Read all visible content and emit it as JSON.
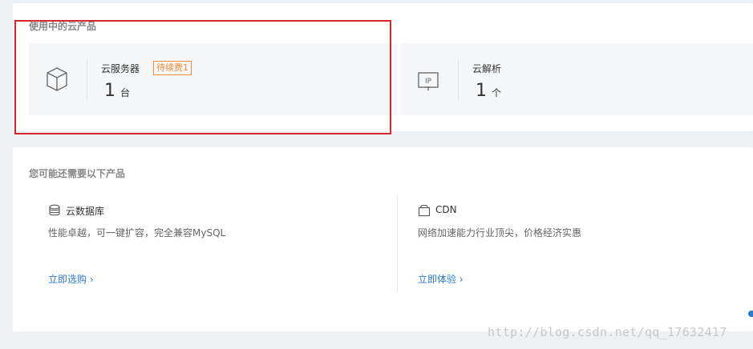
{
  "in_use": {
    "section_title": "使用中的云产品",
    "cards": [
      {
        "icon": "cube-icon",
        "name": "云服务器",
        "badge": "待续费1",
        "count": "1",
        "unit": "台"
      },
      {
        "icon": "ip-icon",
        "name": "云解析",
        "count": "1",
        "unit": "个"
      }
    ]
  },
  "recommend": {
    "section_title": "您可能还需要以下产品",
    "products": [
      {
        "icon": "database-icon",
        "name": "云数据库",
        "description": "性能卓越，可一键扩容，完全兼容MySQL",
        "link": "立即选购"
      },
      {
        "icon": "box-icon",
        "name": "CDN",
        "description": "网络加速能力行业顶尖，价格经济实惠",
        "link": "立即体验"
      }
    ]
  },
  "watermark": "http://blog.csdn.net/qq_17632417",
  "colors": {
    "link": "#2d7bcc",
    "badge": "#f08c3a",
    "highlight": "#d9262b"
  }
}
